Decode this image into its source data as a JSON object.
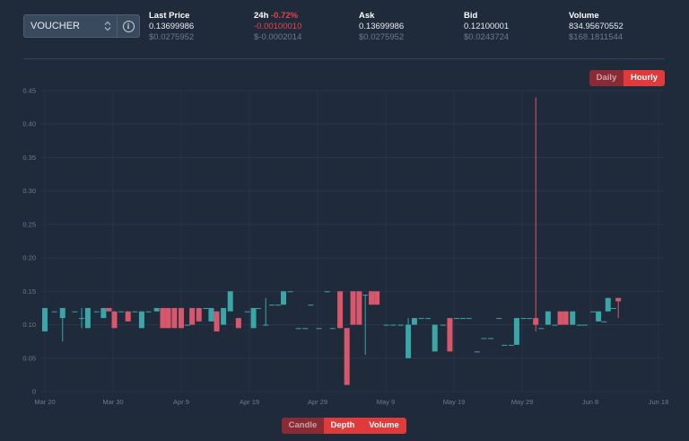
{
  "market": {
    "selected": "VOUCHER",
    "arrows_icon": "chevron-up-down-icon",
    "info_icon": "info-icon"
  },
  "stats": {
    "last_price": {
      "label": "Last Price",
      "value": "0.13699986",
      "usd": "$0.0275952"
    },
    "change_24h": {
      "label": "24h",
      "percent": "-0.72%",
      "value": "-0.00100010",
      "usd": "$-0.0002014"
    },
    "ask": {
      "label": "Ask",
      "value": "0.13699986",
      "usd": "$0.0275952"
    },
    "bid": {
      "label": "Bid",
      "value": "0.12100001",
      "usd": "$0.0243724"
    },
    "volume": {
      "label": "Volume",
      "value": "834.95670552",
      "usd": "$168.1811544"
    }
  },
  "interval_toggle": {
    "daily": "Daily",
    "hourly": "Hourly",
    "active": "Hourly"
  },
  "view_toggle": {
    "candle": "Candle",
    "depth": "Depth",
    "volume": "Volume",
    "active": "Depth"
  },
  "colors": {
    "up": "#3aa6a8",
    "down": "#d9576b",
    "accent": "#e03a3a"
  },
  "chart_data": {
    "type": "candlestick",
    "title": "",
    "xlabel": "",
    "ylabel": "",
    "ylim": [
      0,
      0.45
    ],
    "yticks": [
      "0",
      "0.05",
      "0.10",
      "0.15",
      "0.20",
      "0.25",
      "0.30",
      "0.35",
      "0.40",
      "0.45"
    ],
    "xticks": [
      "Mar 20",
      "Mar 30",
      "Apr 9",
      "Apr 19",
      "Apr 29",
      "May 9",
      "May 19",
      "May 29",
      "Jun 8",
      "Jun 18"
    ],
    "grid": true,
    "candles": [
      {
        "d": 0.0,
        "o": 0.09,
        "h": 0.125,
        "l": 0.09,
        "c": 0.125
      },
      {
        "d": 1.4,
        "o": 0.12,
        "h": 0.12,
        "l": 0.12,
        "c": 0.12
      },
      {
        "d": 2.6,
        "o": 0.11,
        "h": 0.125,
        "l": 0.075,
        "c": 0.125
      },
      {
        "d": 4.4,
        "o": 0.12,
        "h": 0.12,
        "l": 0.12,
        "c": 0.12
      },
      {
        "d": 5.4,
        "o": 0.11,
        "h": 0.125,
        "l": 0.095,
        "c": 0.11
      },
      {
        "d": 6.3,
        "o": 0.095,
        "h": 0.125,
        "l": 0.095,
        "c": 0.125
      },
      {
        "d": 7.6,
        "o": 0.12,
        "h": 0.12,
        "l": 0.12,
        "c": 0.12
      },
      {
        "d": 8.6,
        "o": 0.11,
        "h": 0.125,
        "l": 0.11,
        "c": 0.125
      },
      {
        "d": 9.4,
        "o": 0.125,
        "h": 0.125,
        "l": 0.12,
        "c": 0.12
      },
      {
        "d": 10.2,
        "o": 0.12,
        "h": 0.12,
        "l": 0.095,
        "c": 0.095
      },
      {
        "d": 11.2,
        "o": 0.12,
        "h": 0.12,
        "l": 0.12,
        "c": 0.12
      },
      {
        "d": 12.2,
        "o": 0.12,
        "h": 0.12,
        "l": 0.105,
        "c": 0.105
      },
      {
        "d": 13.2,
        "o": 0.12,
        "h": 0.12,
        "l": 0.12,
        "c": 0.12
      },
      {
        "d": 14.2,
        "o": 0.095,
        "h": 0.12,
        "l": 0.095,
        "c": 0.12
      },
      {
        "d": 15.2,
        "o": 0.12,
        "h": 0.12,
        "l": 0.12,
        "c": 0.12
      },
      {
        "d": 16.4,
        "o": 0.12,
        "h": 0.125,
        "l": 0.12,
        "c": 0.125
      },
      {
        "d": 17.3,
        "o": 0.125,
        "h": 0.125,
        "l": 0.095,
        "c": 0.095
      },
      {
        "d": 18.1,
        "o": 0.125,
        "h": 0.125,
        "l": 0.095,
        "c": 0.095
      },
      {
        "d": 19.0,
        "o": 0.125,
        "h": 0.125,
        "l": 0.095,
        "c": 0.095
      },
      {
        "d": 20.0,
        "o": 0.125,
        "h": 0.125,
        "l": 0.095,
        "c": 0.095
      },
      {
        "d": 20.9,
        "o": 0.1,
        "h": 0.1,
        "l": 0.1,
        "c": 0.1
      },
      {
        "d": 21.6,
        "o": 0.125,
        "h": 0.125,
        "l": 0.1,
        "c": 0.1
      },
      {
        "d": 22.6,
        "o": 0.125,
        "h": 0.125,
        "l": 0.105,
        "c": 0.105
      },
      {
        "d": 23.6,
        "o": 0.125,
        "h": 0.125,
        "l": 0.125,
        "c": 0.125
      },
      {
        "d": 24.4,
        "o": 0.105,
        "h": 0.125,
        "l": 0.105,
        "c": 0.125
      },
      {
        "d": 25.2,
        "o": 0.12,
        "h": 0.12,
        "l": 0.09,
        "c": 0.09
      },
      {
        "d": 26.2,
        "o": 0.1,
        "h": 0.125,
        "l": 0.1,
        "c": 0.125
      },
      {
        "d": 27.2,
        "o": 0.12,
        "h": 0.15,
        "l": 0.12,
        "c": 0.15
      },
      {
        "d": 28.4,
        "o": 0.11,
        "h": 0.11,
        "l": 0.095,
        "c": 0.095
      },
      {
        "d": 29.7,
        "o": 0.12,
        "h": 0.12,
        "l": 0.12,
        "c": 0.12
      },
      {
        "d": 30.6,
        "o": 0.095,
        "h": 0.125,
        "l": 0.095,
        "c": 0.125
      },
      {
        "d": 31.3,
        "o": 0.125,
        "h": 0.125,
        "l": 0.125,
        "c": 0.125
      },
      {
        "d": 32.4,
        "o": 0.1,
        "h": 0.14,
        "l": 0.1,
        "c": 0.1
      },
      {
        "d": 33.3,
        "o": 0.13,
        "h": 0.13,
        "l": 0.13,
        "c": 0.13
      },
      {
        "d": 34.2,
        "o": 0.13,
        "h": 0.13,
        "l": 0.13,
        "c": 0.13
      },
      {
        "d": 35.0,
        "o": 0.13,
        "h": 0.15,
        "l": 0.13,
        "c": 0.15
      },
      {
        "d": 36.0,
        "o": 0.15,
        "h": 0.15,
        "l": 0.15,
        "c": 0.15
      },
      {
        "d": 37.2,
        "o": 0.095,
        "h": 0.095,
        "l": 0.095,
        "c": 0.095
      },
      {
        "d": 38.2,
        "o": 0.095,
        "h": 0.095,
        "l": 0.095,
        "c": 0.095
      },
      {
        "d": 39.0,
        "o": 0.13,
        "h": 0.13,
        "l": 0.13,
        "c": 0.13
      },
      {
        "d": 40.2,
        "o": 0.095,
        "h": 0.095,
        "l": 0.095,
        "c": 0.095
      },
      {
        "d": 41.4,
        "o": 0.15,
        "h": 0.15,
        "l": 0.15,
        "c": 0.15
      },
      {
        "d": 42.2,
        "o": 0.095,
        "h": 0.095,
        "l": 0.095,
        "c": 0.095
      },
      {
        "d": 43.3,
        "o": 0.15,
        "h": 0.15,
        "l": 0.095,
        "c": 0.095
      },
      {
        "d": 44.3,
        "o": 0.095,
        "h": 0.095,
        "l": 0.01,
        "c": 0.01
      },
      {
        "d": 45.2,
        "o": 0.15,
        "h": 0.15,
        "l": 0.1,
        "c": 0.1
      },
      {
        "d": 46.1,
        "o": 0.15,
        "h": 0.15,
        "l": 0.1,
        "c": 0.1
      },
      {
        "d": 47.0,
        "o": 0.145,
        "h": 0.145,
        "l": 0.055,
        "c": 0.145
      },
      {
        "d": 47.9,
        "o": 0.15,
        "h": 0.15,
        "l": 0.13,
        "c": 0.13
      },
      {
        "d": 48.7,
        "o": 0.15,
        "h": 0.15,
        "l": 0.13,
        "c": 0.13
      },
      {
        "d": 50.1,
        "o": 0.1,
        "h": 0.1,
        "l": 0.1,
        "c": 0.1
      },
      {
        "d": 51.1,
        "o": 0.1,
        "h": 0.1,
        "l": 0.1,
        "c": 0.1
      },
      {
        "d": 52.2,
        "o": 0.1,
        "h": 0.1,
        "l": 0.1,
        "c": 0.1
      },
      {
        "d": 53.3,
        "o": 0.05,
        "h": 0.11,
        "l": 0.05,
        "c": 0.1
      },
      {
        "d": 54.2,
        "o": 0.1,
        "h": 0.11,
        "l": 0.1,
        "c": 0.11
      },
      {
        "d": 55.2,
        "o": 0.11,
        "h": 0.11,
        "l": 0.11,
        "c": 0.11
      },
      {
        "d": 56.2,
        "o": 0.11,
        "h": 0.11,
        "l": 0.11,
        "c": 0.11
      },
      {
        "d": 57.2,
        "o": 0.06,
        "h": 0.1,
        "l": 0.06,
        "c": 0.1
      },
      {
        "d": 58.4,
        "o": 0.1,
        "h": 0.1,
        "l": 0.1,
        "c": 0.1
      },
      {
        "d": 59.4,
        "o": 0.11,
        "h": 0.11,
        "l": 0.06,
        "c": 0.06
      },
      {
        "d": 60.4,
        "o": 0.11,
        "h": 0.11,
        "l": 0.11,
        "c": 0.11
      },
      {
        "d": 61.3,
        "o": 0.11,
        "h": 0.11,
        "l": 0.11,
        "c": 0.11
      },
      {
        "d": 62.2,
        "o": 0.11,
        "h": 0.11,
        "l": 0.11,
        "c": 0.11
      },
      {
        "d": 63.4,
        "o": 0.06,
        "h": 0.06,
        "l": 0.06,
        "c": 0.06
      },
      {
        "d": 64.4,
        "o": 0.08,
        "h": 0.08,
        "l": 0.08,
        "c": 0.08
      },
      {
        "d": 65.4,
        "o": 0.08,
        "h": 0.08,
        "l": 0.08,
        "c": 0.08
      },
      {
        "d": 66.6,
        "o": 0.11,
        "h": 0.11,
        "l": 0.11,
        "c": 0.11
      },
      {
        "d": 67.4,
        "o": 0.07,
        "h": 0.07,
        "l": 0.07,
        "c": 0.07
      },
      {
        "d": 68.4,
        "o": 0.07,
        "h": 0.07,
        "l": 0.07,
        "c": 0.07
      },
      {
        "d": 69.2,
        "o": 0.07,
        "h": 0.11,
        "l": 0.07,
        "c": 0.11
      },
      {
        "d": 70.2,
        "o": 0.11,
        "h": 0.11,
        "l": 0.11,
        "c": 0.11
      },
      {
        "d": 71.1,
        "o": 0.11,
        "h": 0.11,
        "l": 0.11,
        "c": 0.11
      },
      {
        "d": 72.0,
        "o": 0.11,
        "h": 0.44,
        "l": 0.09,
        "c": 0.1
      },
      {
        "d": 72.8,
        "o": 0.095,
        "h": 0.095,
        "l": 0.095,
        "c": 0.095
      },
      {
        "d": 73.8,
        "o": 0.1,
        "h": 0.12,
        "l": 0.1,
        "c": 0.12
      },
      {
        "d": 74.8,
        "o": 0.1,
        "h": 0.1,
        "l": 0.1,
        "c": 0.1
      },
      {
        "d": 75.6,
        "o": 0.12,
        "h": 0.12,
        "l": 0.1,
        "c": 0.1
      },
      {
        "d": 76.4,
        "o": 0.12,
        "h": 0.12,
        "l": 0.1,
        "c": 0.1
      },
      {
        "d": 77.4,
        "o": 0.1,
        "h": 0.12,
        "l": 0.1,
        "c": 0.12
      },
      {
        "d": 78.4,
        "o": 0.1,
        "h": 0.1,
        "l": 0.1,
        "c": 0.1
      },
      {
        "d": 79.2,
        "o": 0.1,
        "h": 0.1,
        "l": 0.1,
        "c": 0.1
      },
      {
        "d": 80.4,
        "o": 0.12,
        "h": 0.12,
        "l": 0.12,
        "c": 0.12
      },
      {
        "d": 81.2,
        "o": 0.105,
        "h": 0.12,
        "l": 0.105,
        "c": 0.12
      },
      {
        "d": 82.0,
        "o": 0.105,
        "h": 0.105,
        "l": 0.105,
        "c": 0.105
      },
      {
        "d": 82.6,
        "o": 0.12,
        "h": 0.14,
        "l": 0.12,
        "c": 0.14
      },
      {
        "d": 83.4,
        "o": 0.125,
        "h": 0.125,
        "l": 0.125,
        "c": 0.125
      },
      {
        "d": 84.1,
        "o": 0.14,
        "h": 0.14,
        "l": 0.11,
        "c": 0.135
      }
    ]
  }
}
